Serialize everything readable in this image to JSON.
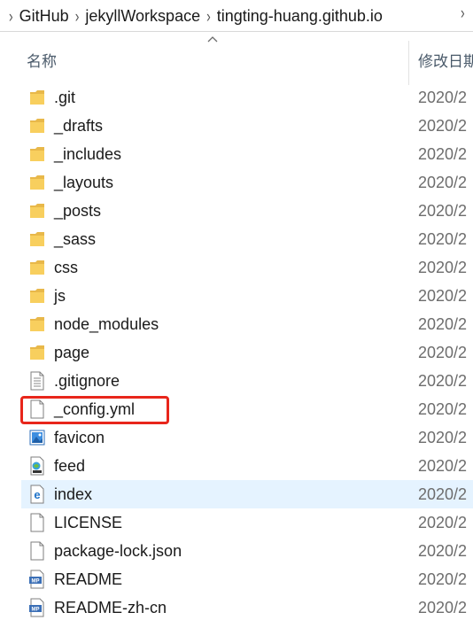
{
  "breadcrumb": {
    "items": [
      "GitHub",
      "jekyllWorkspace",
      "tingting-huang.github.io"
    ],
    "separator": "›"
  },
  "header": {
    "name_label": "名称",
    "date_label": "修改日期"
  },
  "files": [
    {
      "name": ".git",
      "date": "2020/2",
      "type": "folder"
    },
    {
      "name": "_drafts",
      "date": "2020/2",
      "type": "folder"
    },
    {
      "name": "_includes",
      "date": "2020/2",
      "type": "folder"
    },
    {
      "name": "_layouts",
      "date": "2020/2",
      "type": "folder"
    },
    {
      "name": "_posts",
      "date": "2020/2",
      "type": "folder"
    },
    {
      "name": "_sass",
      "date": "2020/2",
      "type": "folder"
    },
    {
      "name": "css",
      "date": "2020/2",
      "type": "folder"
    },
    {
      "name": "js",
      "date": "2020/2",
      "type": "folder"
    },
    {
      "name": "node_modules",
      "date": "2020/2",
      "type": "folder"
    },
    {
      "name": "page",
      "date": "2020/2",
      "type": "folder"
    },
    {
      "name": ".gitignore",
      "date": "2020/2",
      "type": "text-file"
    },
    {
      "name": "_config.yml",
      "date": "2020/2",
      "type": "blank-file",
      "highlighted": true
    },
    {
      "name": "favicon",
      "date": "2020/2",
      "type": "image-file"
    },
    {
      "name": "feed",
      "date": "2020/2",
      "type": "xml-file"
    },
    {
      "name": "index",
      "date": "2020/2",
      "type": "html-file",
      "hover": true
    },
    {
      "name": "LICENSE",
      "date": "2020/2",
      "type": "blank-file"
    },
    {
      "name": "package-lock.json",
      "date": "2020/2",
      "type": "blank-file"
    },
    {
      "name": "README",
      "date": "2020/2",
      "type": "markdown-file"
    },
    {
      "name": "README-zh-cn",
      "date": "2020/2",
      "type": "markdown-file"
    }
  ],
  "colors": {
    "highlight_border": "#e8261b",
    "hover_background": "#e5f3ff",
    "folder_yellow": "#f8cf5e"
  }
}
